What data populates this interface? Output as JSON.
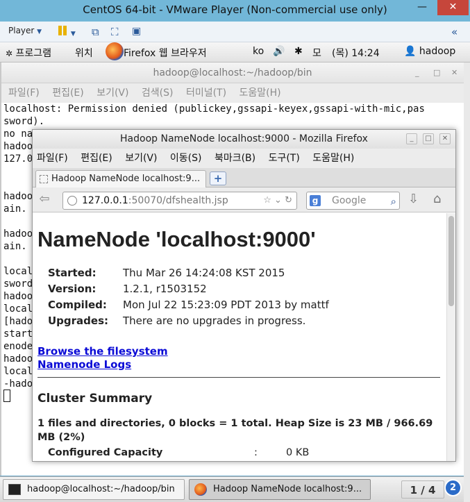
{
  "vmware": {
    "title": "CentOS 64-bit - VMware Player (Non-commercial use only)",
    "player_menu": "Player",
    "minimize_glyph": "—",
    "close_glyph": "✕",
    "collapse_glyph": "«"
  },
  "gnome_panel": {
    "applications": "프로그램",
    "places": "위치",
    "firefox_launcher": "Firefox 웹 브라우저",
    "keyboard_layout": "ko",
    "input_method": "모",
    "clock": "(목) 14:24",
    "user": "hadoop"
  },
  "terminal": {
    "title": "hadoop@localhost:~/hadoop/bin",
    "menu": [
      "파일(F)",
      "편집(E)",
      "보기(V)",
      "검색(S)",
      "터미널(T)",
      "도움말(H)"
    ],
    "lines": [
      "localhost: Permission denied (publickey,gssapi-keyex,gssapi-with-mic,pas",
      "sword).",
      "no na",
      "hadoo",
      "127.0",
      "",
      "",
      "hadoo",
      "ain.",
      "",
      "hadoo",
      "ain.",
      "",
      "local",
      "sword",
      "hadoo",
      "local",
      "[hado",
      "start",
      "enode",
      "hadoo",
      "local",
      "-hado"
    ]
  },
  "firefox": {
    "title": "Hadoop NameNode localhost:9000 - Mozilla Firefox",
    "menu": [
      "파일(F)",
      "편집(E)",
      "보기(V)",
      "이동(S)",
      "북마크(B)",
      "도구(T)",
      "도움말(H)"
    ],
    "tab_title": "Hadoop NameNode localhost:9...",
    "new_tab": "+",
    "url_host": "127.0.0.1",
    "url_rest": ":50070/dfshealth.jsp",
    "search_placeholder": "Google"
  },
  "page": {
    "heading": "NameNode 'localhost:9000'",
    "info": [
      {
        "key": "Started:",
        "value": "Thu Mar 26 14:24:08 KST 2015"
      },
      {
        "key": "Version:",
        "value": "1.2.1, r1503152"
      },
      {
        "key": "Compiled:",
        "value": "Mon Jul 22 15:23:09 PDT 2013 by mattf"
      },
      {
        "key": "Upgrades:",
        "value": "There are no upgrades in progress."
      }
    ],
    "link_browse": "Browse the filesystem",
    "link_logs": "Namenode Logs",
    "cluster_heading": "Cluster Summary",
    "summary_text": "1 files and directories, 0 blocks = 1 total. Heap Size is 23 MB / 966.69 MB (2%)",
    "capacity_label": "Configured Capacity",
    "capacity_colon": ":",
    "capacity_value": "0 KB"
  },
  "taskbar": {
    "terminal_task": "hadoop@localhost:~/hadoop/bin",
    "firefox_task": "Hadoop NameNode localhost:9...",
    "pager": "1 / 4",
    "workspace_badge": "2"
  }
}
